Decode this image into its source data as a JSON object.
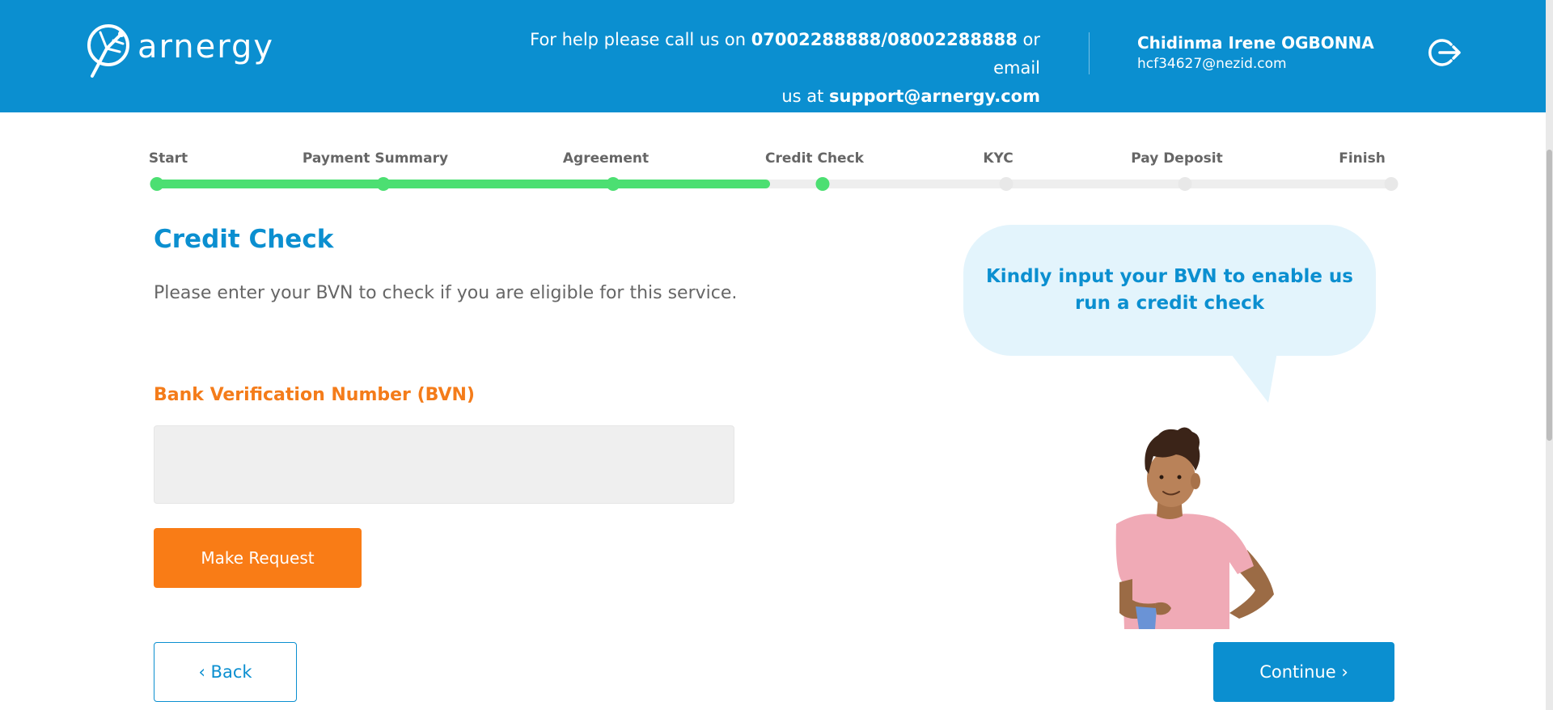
{
  "header": {
    "logo_text": "arnergy",
    "help_prefix": "For help please call us on ",
    "help_phones": "07002288888/08002288888",
    "help_mid": " or email",
    "help_us_at": "us at ",
    "help_email": "support@arnergy.com",
    "user_name": "Chidinma Irene OGBONNA",
    "user_email": "hcf34627@nezid.com",
    "logout_icon": "logout-icon"
  },
  "stepper": {
    "steps": [
      "Start",
      "Payment Summary",
      "Agreement",
      "Credit Check",
      "KYC",
      "Pay Deposit",
      "Finish"
    ],
    "current": "Credit Check"
  },
  "content": {
    "title": "Credit Check",
    "description": "Please enter your BVN to check if you are eligible for this service.",
    "field_label": "Bank Verification Number (BVN)",
    "bvn_value": "",
    "request_button": "Make Request",
    "back_button": "‹ Back",
    "continue_button": "Continue ›"
  },
  "bubble": {
    "text": "Kindly input your BVN to enable us run a credit check"
  },
  "colors": {
    "primary": "#0b8fd0",
    "accent": "#f97c16",
    "progress": "#4cdf72"
  }
}
